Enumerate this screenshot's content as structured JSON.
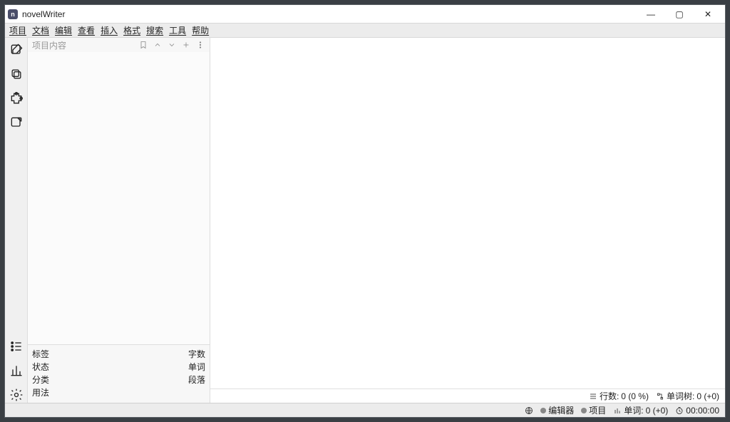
{
  "titlebar": {
    "app_name": "novelWriter"
  },
  "menu": {
    "project": "项目",
    "document": "文档",
    "edit": "编辑",
    "view": "查看",
    "insert": "插入",
    "format": "格式",
    "search": "搜索",
    "tools": "工具",
    "help": "帮助"
  },
  "tree": {
    "header_title": "项目内容",
    "footer_left": {
      "tag": "标签",
      "status": "状态",
      "category": "分类",
      "usage": "用法"
    },
    "footer_right": {
      "chars": "字数",
      "words": "单词",
      "paras": "段落"
    }
  },
  "editor_status": {
    "lines_label": "行数:",
    "lines_value": "0 (0 %)",
    "wordtree_label": "单词树:",
    "wordtree_value": "0 (+0)"
  },
  "bottom_status": {
    "editor_label": "编辑器",
    "project_label": "项目",
    "words_label": "单词:",
    "words_value": "0 (+0)",
    "time_value": "00:00:00"
  }
}
